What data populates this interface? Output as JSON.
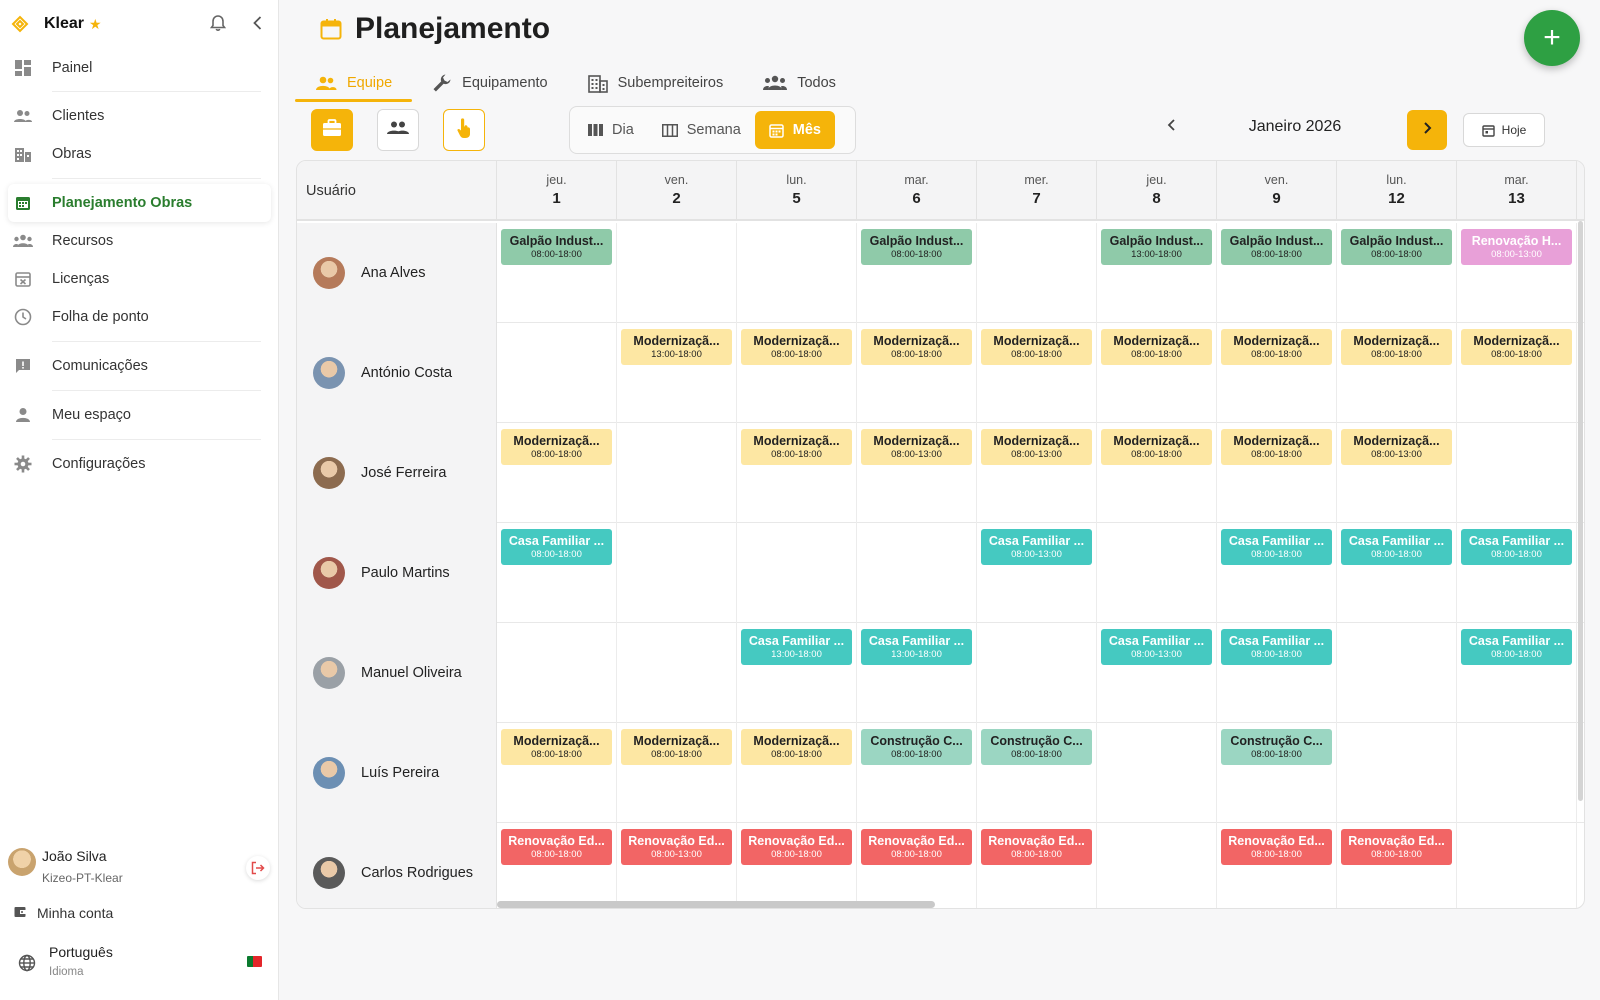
{
  "sidebar": {
    "brand": "Klear",
    "items": [
      {
        "label": "Painel",
        "icon": "dashboard-icon"
      },
      {
        "label": "Clientes",
        "icon": "users-icon"
      },
      {
        "label": "Obras",
        "icon": "building-icon"
      },
      {
        "label": "Planejamento Obras",
        "icon": "calendar-icon",
        "active": true
      },
      {
        "label": "Recursos",
        "icon": "group-icon"
      },
      {
        "label": "Licenças",
        "icon": "calendar-x-icon"
      },
      {
        "label": "Folha de ponto",
        "icon": "clock-icon"
      },
      {
        "label": "Comunicações",
        "icon": "message-alert-icon"
      },
      {
        "label": "Meu espaço",
        "icon": "person-icon"
      },
      {
        "label": "Configurações",
        "icon": "gear-icon"
      }
    ],
    "user": {
      "name": "João Silva",
      "org": "Kizeo-PT-Klear"
    },
    "account_label": "Minha conta",
    "language": {
      "name": "Português",
      "sub": "Idioma"
    }
  },
  "header": {
    "title": "Planejamento",
    "tabs": [
      {
        "label": "Equipe",
        "icon": "people-icon",
        "active": true
      },
      {
        "label": "Equipamento",
        "icon": "wrench-icon"
      },
      {
        "label": "Subempreiteiros",
        "icon": "building-icon"
      },
      {
        "label": "Todos",
        "icon": "group-icon"
      }
    ],
    "views": [
      {
        "label": "Dia",
        "icon": "columns-icon"
      },
      {
        "label": "Semana",
        "icon": "week-icon"
      },
      {
        "label": "Mês",
        "icon": "calendar-month-icon",
        "active": true
      }
    ],
    "month": "Janeiro 2026",
    "today_label": "Hoje"
  },
  "colors": {
    "accent": "#f5b40a",
    "green": "#2ea043",
    "galpao": "#8fcaa9",
    "modernizacao": "#fde7a3",
    "casa": "#45c9c1",
    "construcao": "#9bd6c2",
    "renovacao_ed": "#f26565",
    "renovacao_h": "#e8a0d8"
  },
  "grid": {
    "user_col": "Usuário",
    "days": [
      {
        "dw": "jeu.",
        "dn": "1"
      },
      {
        "dw": "ven.",
        "dn": "2"
      },
      {
        "dw": "lun.",
        "dn": "5"
      },
      {
        "dw": "mar.",
        "dn": "6"
      },
      {
        "dw": "mer.",
        "dn": "7"
      },
      {
        "dw": "jeu.",
        "dn": "8"
      },
      {
        "dw": "ven.",
        "dn": "9"
      },
      {
        "dw": "lun.",
        "dn": "12"
      },
      {
        "dw": "mar.",
        "dn": "13"
      }
    ],
    "rows": [
      {
        "name": "Ana Alves",
        "events": [
          {
            "col": 0,
            "name": "Galpão Indust...",
            "time": "08:00-18:00",
            "kind": "galpao"
          },
          {
            "col": 3,
            "name": "Galpão Indust...",
            "time": "08:00-18:00",
            "kind": "galpao"
          },
          {
            "col": 5,
            "name": "Galpão Indust...",
            "time": "13:00-18:00",
            "kind": "galpao"
          },
          {
            "col": 6,
            "name": "Galpão Indust...",
            "time": "08:00-18:00",
            "kind": "galpao"
          },
          {
            "col": 7,
            "name": "Galpão Indust...",
            "time": "08:00-18:00",
            "kind": "galpao"
          },
          {
            "col": 8,
            "name": "Renovação H...",
            "time": "08:00-13:00",
            "kind": "renovacao_h"
          }
        ]
      },
      {
        "name": "António Costa",
        "events": [
          {
            "col": 1,
            "name": "Modernizaçã...",
            "time": "13:00-18:00",
            "kind": "modernizacao"
          },
          {
            "col": 2,
            "name": "Modernizaçã...",
            "time": "08:00-18:00",
            "kind": "modernizacao"
          },
          {
            "col": 3,
            "name": "Modernizaçã...",
            "time": "08:00-18:00",
            "kind": "modernizacao"
          },
          {
            "col": 4,
            "name": "Modernizaçã...",
            "time": "08:00-18:00",
            "kind": "modernizacao"
          },
          {
            "col": 5,
            "name": "Modernizaçã...",
            "time": "08:00-18:00",
            "kind": "modernizacao"
          },
          {
            "col": 6,
            "name": "Modernizaçã...",
            "time": "08:00-18:00",
            "kind": "modernizacao"
          },
          {
            "col": 7,
            "name": "Modernizaçã...",
            "time": "08:00-18:00",
            "kind": "modernizacao"
          },
          {
            "col": 8,
            "name": "Modernizaçã...",
            "time": "08:00-18:00",
            "kind": "modernizacao"
          }
        ]
      },
      {
        "name": "José Ferreira",
        "events": [
          {
            "col": 0,
            "name": "Modernizaçã...",
            "time": "08:00-18:00",
            "kind": "modernizacao"
          },
          {
            "col": 2,
            "name": "Modernizaçã...",
            "time": "08:00-18:00",
            "kind": "modernizacao"
          },
          {
            "col": 3,
            "name": "Modernizaçã...",
            "time": "08:00-13:00",
            "kind": "modernizacao"
          },
          {
            "col": 4,
            "name": "Modernizaçã...",
            "time": "08:00-13:00",
            "kind": "modernizacao"
          },
          {
            "col": 5,
            "name": "Modernizaçã...",
            "time": "08:00-18:00",
            "kind": "modernizacao"
          },
          {
            "col": 6,
            "name": "Modernizaçã...",
            "time": "08:00-18:00",
            "kind": "modernizacao"
          },
          {
            "col": 7,
            "name": "Modernizaçã...",
            "time": "08:00-13:00",
            "kind": "modernizacao"
          }
        ]
      },
      {
        "name": "Paulo Martins",
        "events": [
          {
            "col": 0,
            "name": "Casa Familiar ...",
            "time": "08:00-18:00",
            "kind": "casa"
          },
          {
            "col": 4,
            "name": "Casa Familiar ...",
            "time": "08:00-13:00",
            "kind": "casa"
          },
          {
            "col": 6,
            "name": "Casa Familiar ...",
            "time": "08:00-18:00",
            "kind": "casa"
          },
          {
            "col": 7,
            "name": "Casa Familiar ...",
            "time": "08:00-18:00",
            "kind": "casa"
          },
          {
            "col": 8,
            "name": "Casa Familiar ...",
            "time": "08:00-18:00",
            "kind": "casa"
          }
        ]
      },
      {
        "name": "Manuel Oliveira",
        "events": [
          {
            "col": 2,
            "name": "Casa Familiar ...",
            "time": "13:00-18:00",
            "kind": "casa"
          },
          {
            "col": 3,
            "name": "Casa Familiar ...",
            "time": "13:00-18:00",
            "kind": "casa"
          },
          {
            "col": 5,
            "name": "Casa Familiar ...",
            "time": "08:00-13:00",
            "kind": "casa"
          },
          {
            "col": 6,
            "name": "Casa Familiar ...",
            "time": "08:00-18:00",
            "kind": "casa"
          },
          {
            "col": 8,
            "name": "Casa Familiar ...",
            "time": "08:00-18:00",
            "kind": "casa"
          }
        ]
      },
      {
        "name": "Luís Pereira",
        "events": [
          {
            "col": 0,
            "name": "Modernizaçã...",
            "time": "08:00-18:00",
            "kind": "modernizacao"
          },
          {
            "col": 1,
            "name": "Modernizaçã...",
            "time": "08:00-18:00",
            "kind": "modernizacao"
          },
          {
            "col": 2,
            "name": "Modernizaçã...",
            "time": "08:00-18:00",
            "kind": "modernizacao"
          },
          {
            "col": 3,
            "name": "Construção C...",
            "time": "08:00-18:00",
            "kind": "construcao"
          },
          {
            "col": 4,
            "name": "Construção C...",
            "time": "08:00-18:00",
            "kind": "construcao"
          },
          {
            "col": 6,
            "name": "Construção C...",
            "time": "08:00-18:00",
            "kind": "construcao"
          }
        ]
      },
      {
        "name": "Carlos Rodrigues",
        "events": [
          {
            "col": 0,
            "name": "Renovação Ed...",
            "time": "08:00-18:00",
            "kind": "renovacao_ed"
          },
          {
            "col": 1,
            "name": "Renovação Ed...",
            "time": "08:00-13:00",
            "kind": "renovacao_ed"
          },
          {
            "col": 2,
            "name": "Renovação Ed...",
            "time": "08:00-18:00",
            "kind": "renovacao_ed"
          },
          {
            "col": 3,
            "name": "Renovação Ed...",
            "time": "08:00-18:00",
            "kind": "renovacao_ed"
          },
          {
            "col": 4,
            "name": "Renovação Ed...",
            "time": "08:00-18:00",
            "kind": "renovacao_ed"
          },
          {
            "col": 6,
            "name": "Renovação Ed...",
            "time": "08:00-18:00",
            "kind": "renovacao_ed"
          },
          {
            "col": 7,
            "name": "Renovação Ed...",
            "time": "08:00-18:00",
            "kind": "renovacao_ed"
          }
        ]
      }
    ]
  }
}
